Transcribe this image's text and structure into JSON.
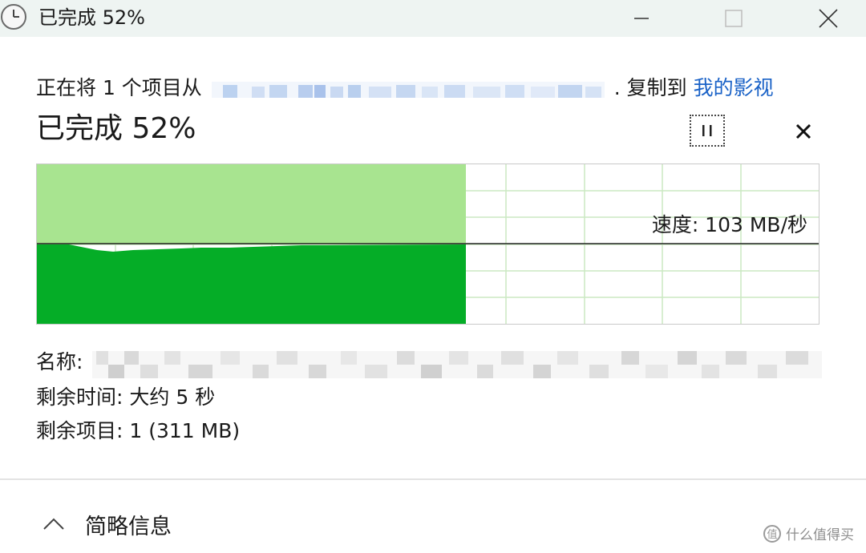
{
  "window": {
    "title": "已完成 52%",
    "icon": "clock-icon",
    "controls": {
      "minimize": "minimize-icon",
      "maximize": "maximize-icon",
      "close": "close-icon"
    }
  },
  "copy": {
    "prefix": "正在将 1 个项目从",
    "source": "",
    "middle": ". 复制到",
    "destination": "我的影视",
    "status": "已完成 52%",
    "progress_percent": 52
  },
  "actions": {
    "pause_icon": "pause-icon",
    "cancel_icon": "cancel-icon"
  },
  "graph": {
    "speed_label": "速度: 103 MB/秒",
    "colors": {
      "fill_light": "#a8e490",
      "fill_dark": "#05ad27",
      "grid": "#cbe9c2"
    }
  },
  "details": {
    "name_label": "名称:",
    "name_value": "",
    "time_label": "剩余时间:",
    "time_value": "大约 5 秒",
    "items_label": "剩余项目:",
    "items_value": "1 (311 MB)"
  },
  "footer": {
    "toggle_label": "简略信息",
    "toggle_icon": "chevron-up-icon",
    "watermark": "什么值得买"
  }
}
